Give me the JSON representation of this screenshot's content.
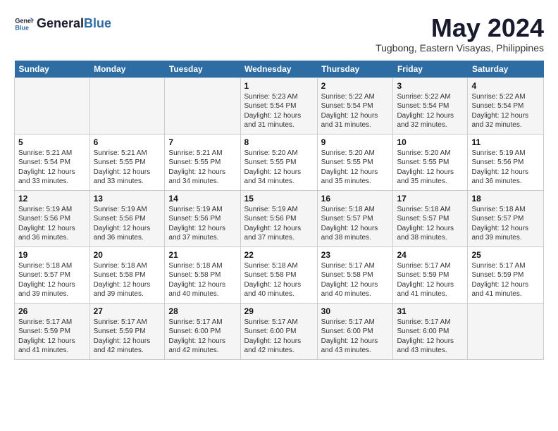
{
  "logo": {
    "line1": "General",
    "line2": "Blue"
  },
  "title": "May 2024",
  "subtitle": "Tugbong, Eastern Visayas, Philippines",
  "weekdays": [
    "Sunday",
    "Monday",
    "Tuesday",
    "Wednesday",
    "Thursday",
    "Friday",
    "Saturday"
  ],
  "weeks": [
    [
      {
        "day": "",
        "sunrise": "",
        "sunset": "",
        "daylight": ""
      },
      {
        "day": "",
        "sunrise": "",
        "sunset": "",
        "daylight": ""
      },
      {
        "day": "",
        "sunrise": "",
        "sunset": "",
        "daylight": ""
      },
      {
        "day": "1",
        "sunrise": "Sunrise: 5:23 AM",
        "sunset": "Sunset: 5:54 PM",
        "daylight": "Daylight: 12 hours and 31 minutes."
      },
      {
        "day": "2",
        "sunrise": "Sunrise: 5:22 AM",
        "sunset": "Sunset: 5:54 PM",
        "daylight": "Daylight: 12 hours and 31 minutes."
      },
      {
        "day": "3",
        "sunrise": "Sunrise: 5:22 AM",
        "sunset": "Sunset: 5:54 PM",
        "daylight": "Daylight: 12 hours and 32 minutes."
      },
      {
        "day": "4",
        "sunrise": "Sunrise: 5:22 AM",
        "sunset": "Sunset: 5:54 PM",
        "daylight": "Daylight: 12 hours and 32 minutes."
      }
    ],
    [
      {
        "day": "5",
        "sunrise": "Sunrise: 5:21 AM",
        "sunset": "Sunset: 5:54 PM",
        "daylight": "Daylight: 12 hours and 33 minutes."
      },
      {
        "day": "6",
        "sunrise": "Sunrise: 5:21 AM",
        "sunset": "Sunset: 5:55 PM",
        "daylight": "Daylight: 12 hours and 33 minutes."
      },
      {
        "day": "7",
        "sunrise": "Sunrise: 5:21 AM",
        "sunset": "Sunset: 5:55 PM",
        "daylight": "Daylight: 12 hours and 34 minutes."
      },
      {
        "day": "8",
        "sunrise": "Sunrise: 5:20 AM",
        "sunset": "Sunset: 5:55 PM",
        "daylight": "Daylight: 12 hours and 34 minutes."
      },
      {
        "day": "9",
        "sunrise": "Sunrise: 5:20 AM",
        "sunset": "Sunset: 5:55 PM",
        "daylight": "Daylight: 12 hours and 35 minutes."
      },
      {
        "day": "10",
        "sunrise": "Sunrise: 5:20 AM",
        "sunset": "Sunset: 5:55 PM",
        "daylight": "Daylight: 12 hours and 35 minutes."
      },
      {
        "day": "11",
        "sunrise": "Sunrise: 5:19 AM",
        "sunset": "Sunset: 5:56 PM",
        "daylight": "Daylight: 12 hours and 36 minutes."
      }
    ],
    [
      {
        "day": "12",
        "sunrise": "Sunrise: 5:19 AM",
        "sunset": "Sunset: 5:56 PM",
        "daylight": "Daylight: 12 hours and 36 minutes."
      },
      {
        "day": "13",
        "sunrise": "Sunrise: 5:19 AM",
        "sunset": "Sunset: 5:56 PM",
        "daylight": "Daylight: 12 hours and 36 minutes."
      },
      {
        "day": "14",
        "sunrise": "Sunrise: 5:19 AM",
        "sunset": "Sunset: 5:56 PM",
        "daylight": "Daylight: 12 hours and 37 minutes."
      },
      {
        "day": "15",
        "sunrise": "Sunrise: 5:19 AM",
        "sunset": "Sunset: 5:56 PM",
        "daylight": "Daylight: 12 hours and 37 minutes."
      },
      {
        "day": "16",
        "sunrise": "Sunrise: 5:18 AM",
        "sunset": "Sunset: 5:57 PM",
        "daylight": "Daylight: 12 hours and 38 minutes."
      },
      {
        "day": "17",
        "sunrise": "Sunrise: 5:18 AM",
        "sunset": "Sunset: 5:57 PM",
        "daylight": "Daylight: 12 hours and 38 minutes."
      },
      {
        "day": "18",
        "sunrise": "Sunrise: 5:18 AM",
        "sunset": "Sunset: 5:57 PM",
        "daylight": "Daylight: 12 hours and 39 minutes."
      }
    ],
    [
      {
        "day": "19",
        "sunrise": "Sunrise: 5:18 AM",
        "sunset": "Sunset: 5:57 PM",
        "daylight": "Daylight: 12 hours and 39 minutes."
      },
      {
        "day": "20",
        "sunrise": "Sunrise: 5:18 AM",
        "sunset": "Sunset: 5:58 PM",
        "daylight": "Daylight: 12 hours and 39 minutes."
      },
      {
        "day": "21",
        "sunrise": "Sunrise: 5:18 AM",
        "sunset": "Sunset: 5:58 PM",
        "daylight": "Daylight: 12 hours and 40 minutes."
      },
      {
        "day": "22",
        "sunrise": "Sunrise: 5:18 AM",
        "sunset": "Sunset: 5:58 PM",
        "daylight": "Daylight: 12 hours and 40 minutes."
      },
      {
        "day": "23",
        "sunrise": "Sunrise: 5:17 AM",
        "sunset": "Sunset: 5:58 PM",
        "daylight": "Daylight: 12 hours and 40 minutes."
      },
      {
        "day": "24",
        "sunrise": "Sunrise: 5:17 AM",
        "sunset": "Sunset: 5:59 PM",
        "daylight": "Daylight: 12 hours and 41 minutes."
      },
      {
        "day": "25",
        "sunrise": "Sunrise: 5:17 AM",
        "sunset": "Sunset: 5:59 PM",
        "daylight": "Daylight: 12 hours and 41 minutes."
      }
    ],
    [
      {
        "day": "26",
        "sunrise": "Sunrise: 5:17 AM",
        "sunset": "Sunset: 5:59 PM",
        "daylight": "Daylight: 12 hours and 41 minutes."
      },
      {
        "day": "27",
        "sunrise": "Sunrise: 5:17 AM",
        "sunset": "Sunset: 5:59 PM",
        "daylight": "Daylight: 12 hours and 42 minutes."
      },
      {
        "day": "28",
        "sunrise": "Sunrise: 5:17 AM",
        "sunset": "Sunset: 6:00 PM",
        "daylight": "Daylight: 12 hours and 42 minutes."
      },
      {
        "day": "29",
        "sunrise": "Sunrise: 5:17 AM",
        "sunset": "Sunset: 6:00 PM",
        "daylight": "Daylight: 12 hours and 42 minutes."
      },
      {
        "day": "30",
        "sunrise": "Sunrise: 5:17 AM",
        "sunset": "Sunset: 6:00 PM",
        "daylight": "Daylight: 12 hours and 43 minutes."
      },
      {
        "day": "31",
        "sunrise": "Sunrise: 5:17 AM",
        "sunset": "Sunset: 6:00 PM",
        "daylight": "Daylight: 12 hours and 43 minutes."
      },
      {
        "day": "",
        "sunrise": "",
        "sunset": "",
        "daylight": ""
      }
    ]
  ]
}
